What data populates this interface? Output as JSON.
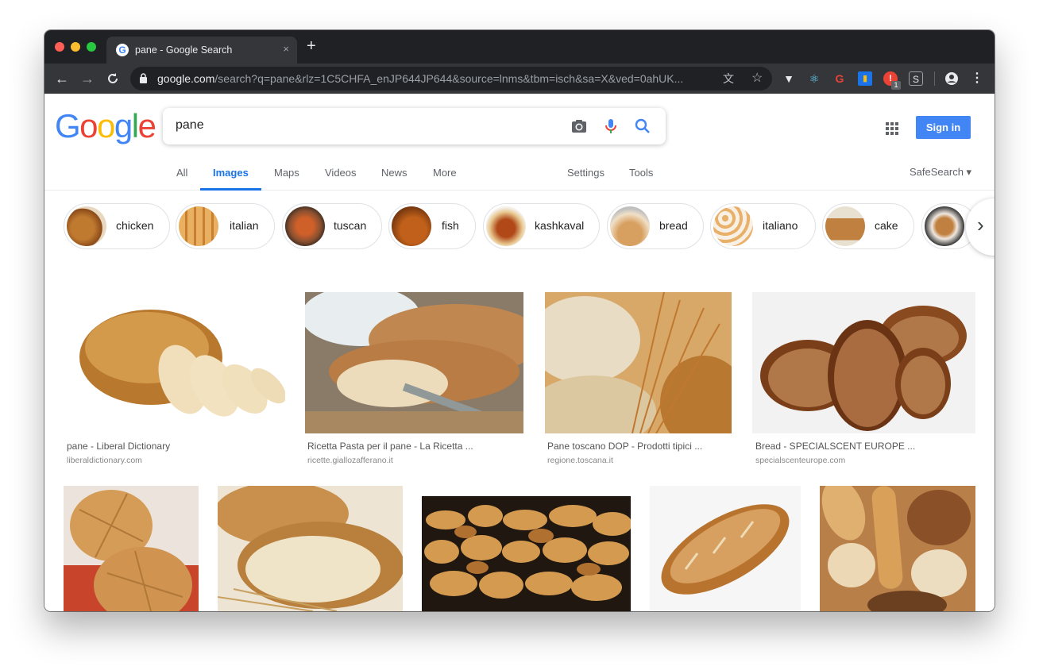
{
  "browser": {
    "tab_title": "pane - Google Search",
    "tab_close": "×",
    "new_tab": "+",
    "url_host": "google.com",
    "url_path": "/search?q=pane&rlz=1C5CHFA_enJP644JP644&source=lnms&tbm=isch&sa=X&ved=0ahUK...",
    "extension_badge": "1"
  },
  "google": {
    "logo": "Google",
    "search_query": "pane",
    "sign_in": "Sign in",
    "tabs": [
      "All",
      "Images",
      "Maps",
      "Videos",
      "News",
      "More"
    ],
    "settings": "Settings",
    "tools": "Tools",
    "safesearch": "SafeSearch ▾",
    "chips": [
      "chicken",
      "italian",
      "tuscan",
      "fish",
      "kashkaval",
      "bread",
      "italiano",
      "cake"
    ],
    "results_row1": [
      {
        "title": "pane - Liberal Dictionary",
        "source": "liberaldictionary.com"
      },
      {
        "title": "Ricetta Pasta per il pane - La Ricetta ...",
        "source": "ricette.giallozafferano.it"
      },
      {
        "title": "Pane toscano DOP - Prodotti tipici ...",
        "source": "regione.toscana.it"
      },
      {
        "title": "Bread - SPECIALSCENT EUROPE ...",
        "source": "specialscenteurope.com"
      }
    ],
    "accent_color": "#1a73e8",
    "sign_in_color": "#4285f4"
  }
}
